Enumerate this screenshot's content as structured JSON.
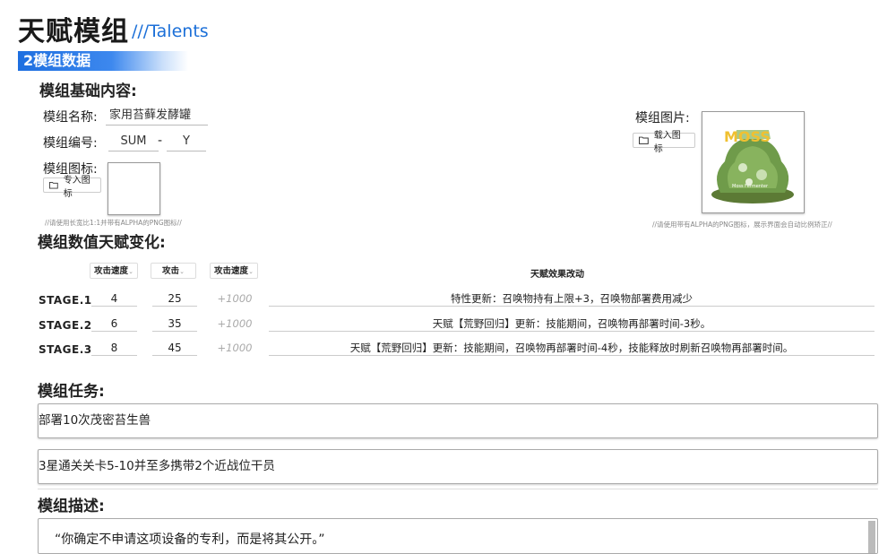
{
  "header": {
    "title": "天赋模组",
    "subtitle": "///Talents"
  },
  "section": {
    "label": "2模组数据"
  },
  "basics": {
    "heading": "模组基础内容:",
    "name_label": "模组名称:",
    "name_value": "家用苔藓发酵罐",
    "code_label": "模组编号:",
    "code_prefix": "SUM",
    "code_sep": "-",
    "code_suffix": "Y",
    "icon_label": "模组图标:",
    "icon_button": "专入图标",
    "icon_hint": "//请使用长宽比1:1并带有ALPHA的PNG图标//",
    "image_label": "模组图片:",
    "image_button": "载入图标",
    "image_hint": "//请使用带有ALPHA的PNG图标，展示界面会自动比例矫正//",
    "image_text_top": "MOSS",
    "image_text_bottom": "Moss Fermenter"
  },
  "stats": {
    "heading": "模组数值天赋变化:",
    "columns": [
      "攻击速度",
      "攻击",
      "攻击速度"
    ],
    "effect_header": "天赋效果改动",
    "rows": [
      {
        "stage": "STAGE.1",
        "v1": "4",
        "v2": "25",
        "v3": "+1000",
        "effect": "特性更新：召唤物持有上限+3，召唤物部署费用减少"
      },
      {
        "stage": "STAGE.2",
        "v1": "6",
        "v2": "35",
        "v3": "+1000",
        "effect": "天赋【荒野回归】更新：技能期间，召唤物再部署时间-3秒。"
      },
      {
        "stage": "STAGE.3",
        "v1": "8",
        "v2": "45",
        "v3": "+1000",
        "effect": "天赋【荒野回归】更新：技能期间，召唤物再部署时间-4秒，技能释放时刷新召唤物再部署时间。"
      }
    ]
  },
  "tasks": {
    "heading": "模组任务:",
    "items": [
      "部署10次茂密苔生兽",
      "3星通关关卡5-10并至多携带2个近战位干员"
    ]
  },
  "description": {
    "heading": "模组描述:",
    "text": "“你确定不申请这项设备的专利，而是将其公开。”"
  },
  "colors": {
    "accent": "#1e6fe0",
    "subtitle": "#1b6fd8"
  }
}
